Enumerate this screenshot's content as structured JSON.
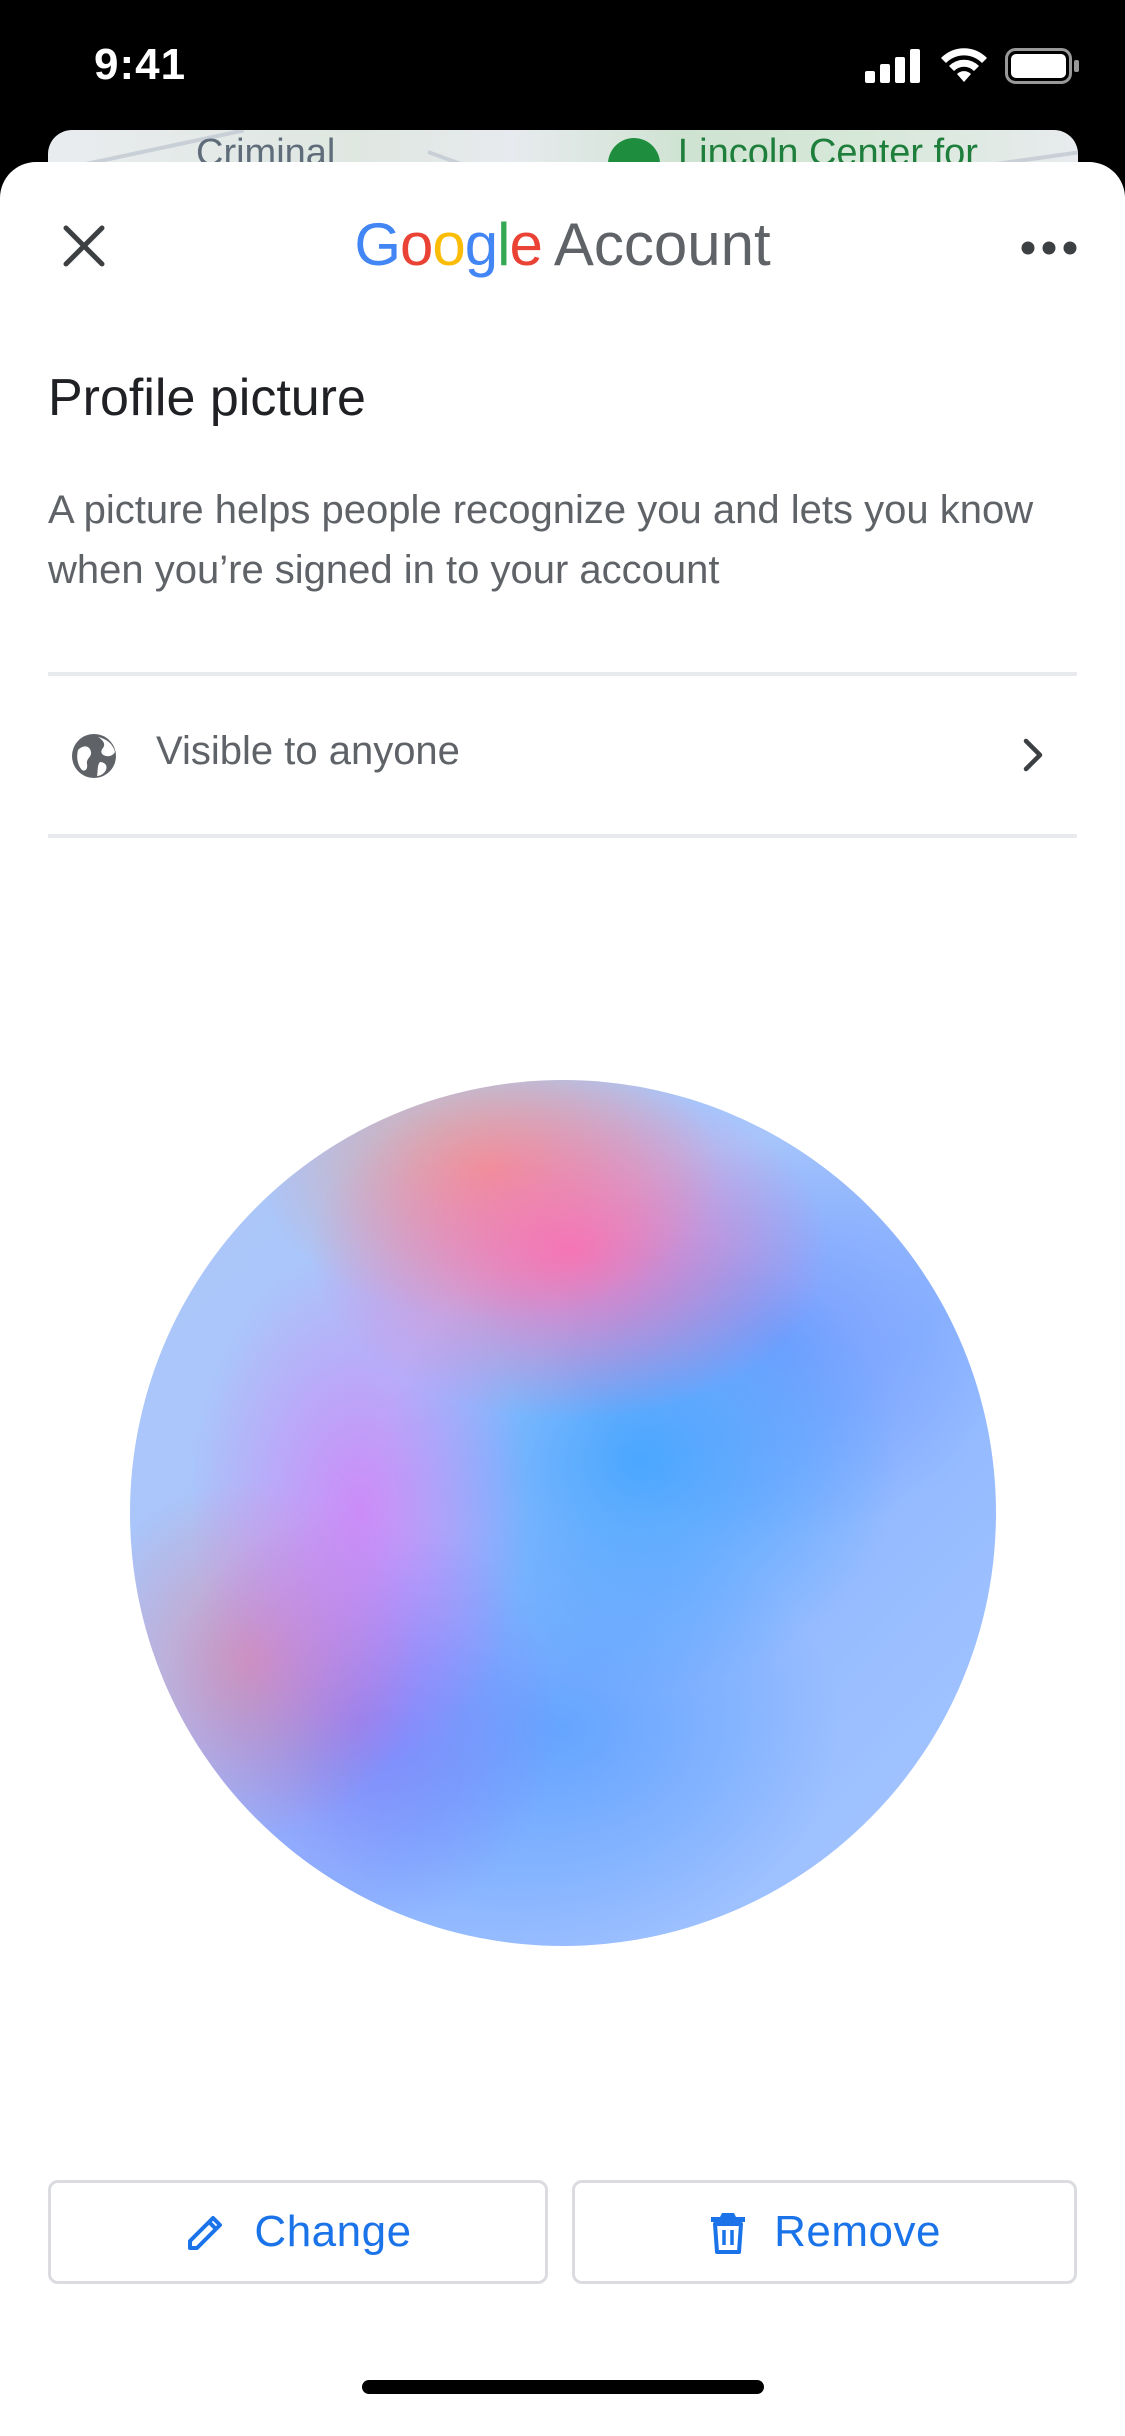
{
  "status_bar": {
    "time": "9:41",
    "icons": [
      "cellular-signal-icon",
      "wifi-icon",
      "battery-icon"
    ]
  },
  "background_map": {
    "labels": [
      "Criminal",
      "Lincoln Center for"
    ]
  },
  "header": {
    "brand_google": "Google",
    "brand_account": "Account",
    "close_icon": "close-icon",
    "more_icon": "more-options-icon"
  },
  "page": {
    "title": "Profile picture",
    "description": "A picture helps people recognize you and lets you know when you’re signed in to your account"
  },
  "visibility": {
    "label": "Visible to anyone",
    "icon": "globe-icon",
    "chevron": "chevron-right-icon"
  },
  "actions": {
    "change_label": "Change",
    "change_icon": "pencil-icon",
    "remove_label": "Remove",
    "remove_icon": "trash-icon"
  },
  "colors": {
    "accent": "#1a73e8",
    "google_blue": "#4285F4",
    "google_red": "#EA4335",
    "google_yellow": "#FBBC05",
    "google_green": "#34A853",
    "secondary_text": "#5f6368",
    "primary_text": "#202124"
  }
}
